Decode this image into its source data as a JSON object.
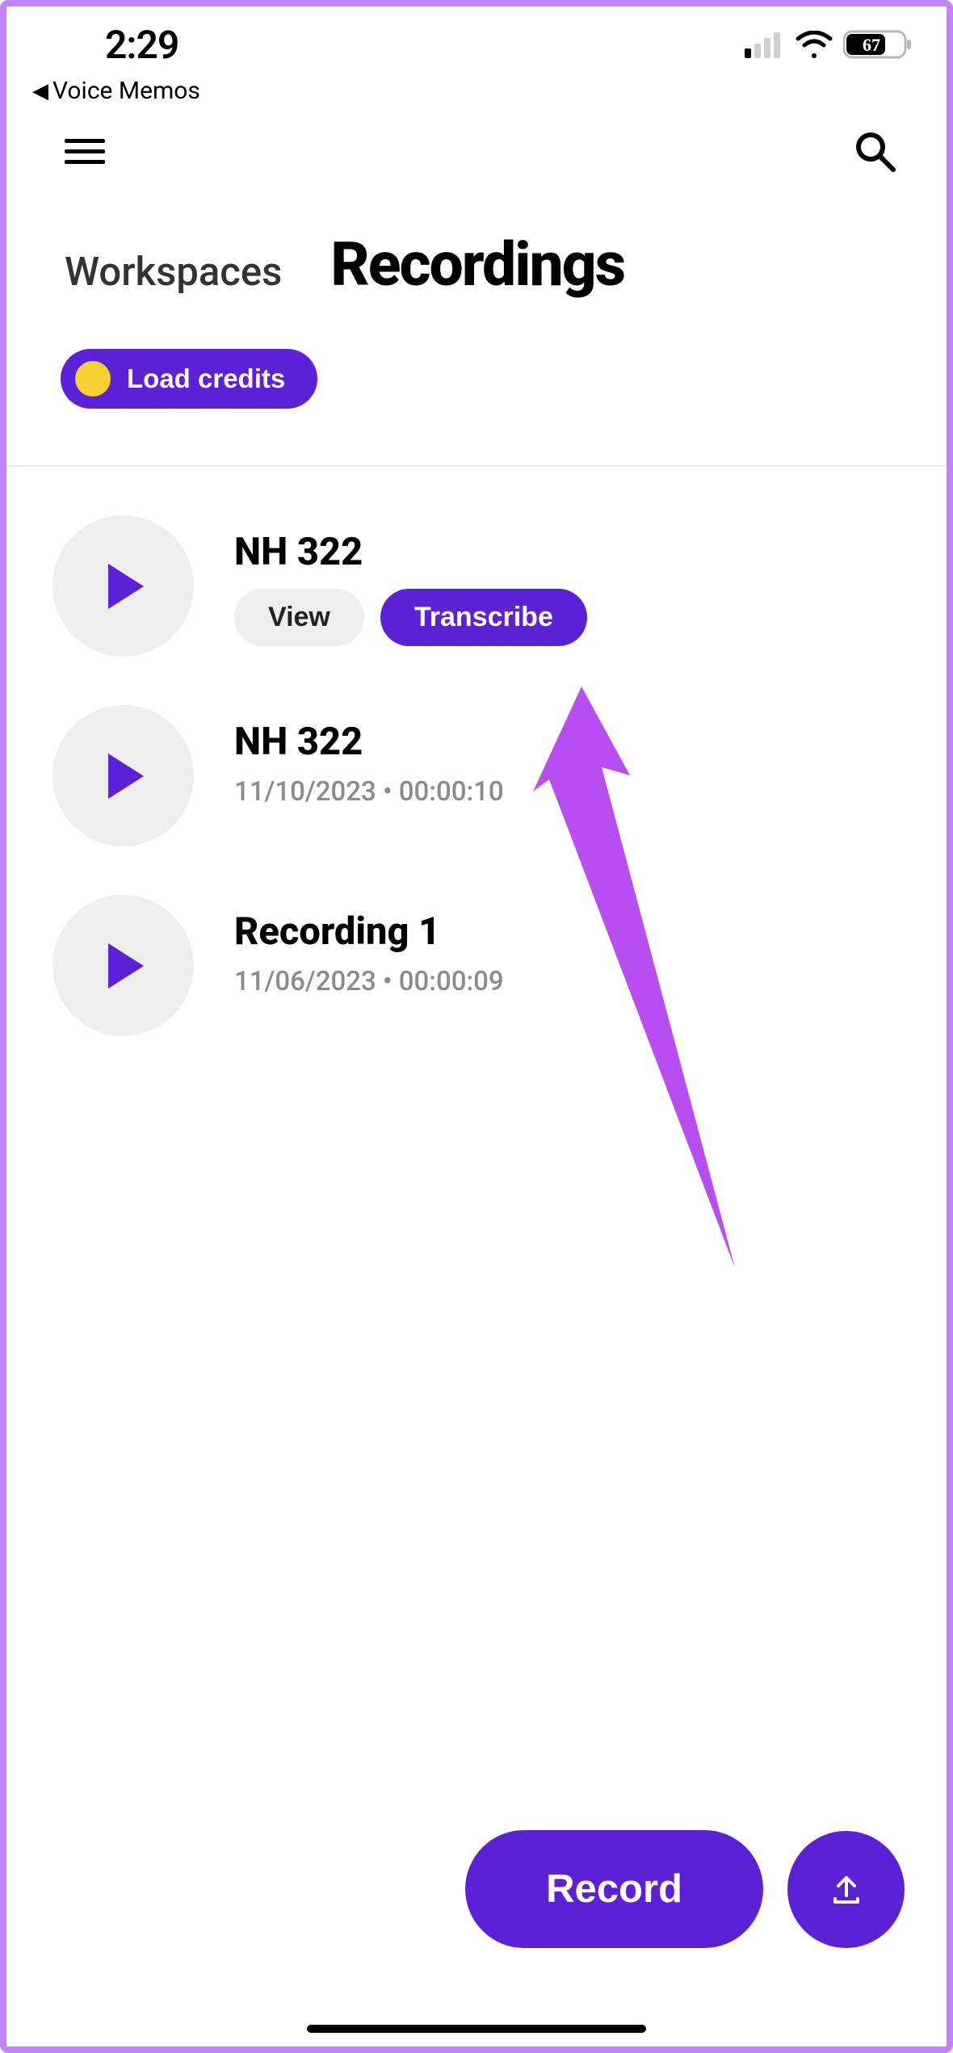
{
  "statusBar": {
    "time": "2:29",
    "battery": "67"
  },
  "backNav": {
    "label": "Voice Memos"
  },
  "nav": {
    "workspaces": "Workspaces",
    "recordings": "Recordings"
  },
  "loadCredits": {
    "label": "Load credits"
  },
  "recordings": [
    {
      "title": "NH 322",
      "expanded": true,
      "viewLabel": "View",
      "transcribeLabel": "Transcribe"
    },
    {
      "title": "NH 322",
      "meta": "11/10/2023 • 00:00:10"
    },
    {
      "title": "Recording 1",
      "meta": "11/06/2023 • 00:00:09"
    }
  ],
  "bottom": {
    "record": "Record"
  },
  "colors": {
    "accent": "#5b21d6",
    "arrow": "#b84df2",
    "yellow": "#f5d033"
  }
}
